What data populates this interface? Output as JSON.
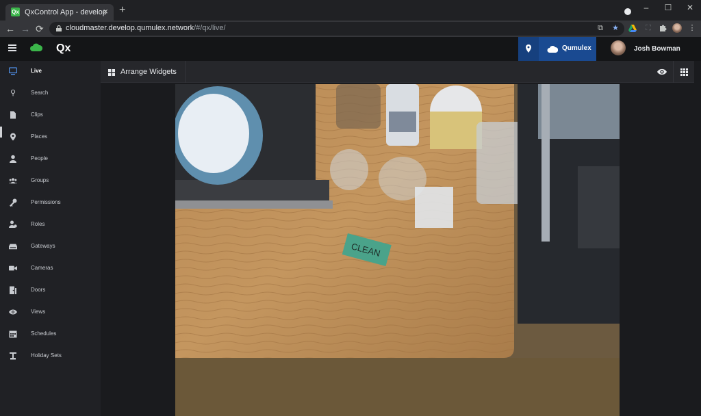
{
  "browser": {
    "tab_title": "QxControl App - develop",
    "tab_close": "×",
    "new_tab": "+",
    "url_host": "cloudmaster.develop.qumulex.network",
    "url_path": "/#/qx/live/",
    "window_controls": [
      "–",
      "☐",
      "✕"
    ]
  },
  "app": {
    "brand": "Qx",
    "location_label": "Qumulex",
    "user_name": "Josh Bowman"
  },
  "sidebar": {
    "items": [
      {
        "label": "Live",
        "icon": "monitor-icon",
        "active": true
      },
      {
        "label": "Search",
        "icon": "search-icon"
      },
      {
        "label": "Clips",
        "icon": "file-icon"
      },
      {
        "label": "Places",
        "icon": "pin-icon"
      },
      {
        "label": "People",
        "icon": "person-icon"
      },
      {
        "label": "Groups",
        "icon": "group-icon"
      },
      {
        "label": "Permissions",
        "icon": "key-icon"
      },
      {
        "label": "Roles",
        "icon": "roles-icon"
      },
      {
        "label": "Gateways",
        "icon": "gateway-icon"
      },
      {
        "label": "Cameras",
        "icon": "camera-icon"
      },
      {
        "label": "Doors",
        "icon": "door-icon"
      },
      {
        "label": "Views",
        "icon": "eye-icon"
      },
      {
        "label": "Schedules",
        "icon": "calendar-icon"
      },
      {
        "label": "Holiday Sets",
        "icon": "holiday-icon"
      }
    ]
  },
  "main": {
    "arrange_label": "Arrange Widgets",
    "feed_sign_text": "CLEAN"
  },
  "colors": {
    "accent_blue": "#1a4a91",
    "active_icon": "#4f8fe6",
    "brand_green": "#3bb54a"
  }
}
